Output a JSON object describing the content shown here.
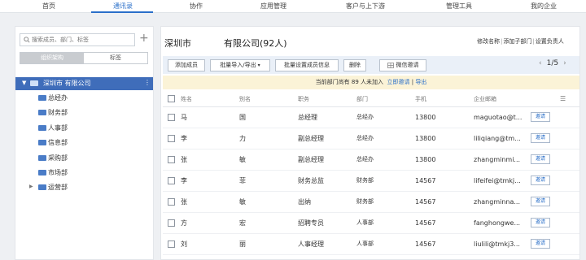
{
  "topnav": {
    "items": [
      {
        "label": "首页"
      },
      {
        "label": "通讯录",
        "active": true
      },
      {
        "label": "协作"
      },
      {
        "label": "应用管理"
      },
      {
        "label": "客户与上下游"
      },
      {
        "label": "管理工具"
      },
      {
        "label": "我的企业"
      }
    ]
  },
  "sidebar": {
    "search_placeholder": "搜索成员、部门、标签",
    "add_symbol": "+",
    "seg_tabs": [
      "组织架构",
      "标签"
    ],
    "root": {
      "caret": "▼",
      "name": "深圳市          有限公司",
      "more": "⋮"
    },
    "departments": [
      {
        "name": "总经办"
      },
      {
        "name": "财务部"
      },
      {
        "name": "人事部"
      },
      {
        "name": "信息部"
      },
      {
        "name": "采购部"
      },
      {
        "name": "市场部"
      },
      {
        "name": "运营部",
        "caret": "▶"
      }
    ]
  },
  "main": {
    "title_left": "深圳市",
    "title_right": "有限公司(92人)",
    "links": [
      "修改名称",
      "添加子部门",
      "设置负责人"
    ],
    "link_sep": "|",
    "toolbar": {
      "add_member": "添加成员",
      "bulk_import": "批量导入/导出",
      "bulk_import_chevron": "▾",
      "bulk_set": "批量设置成员信息",
      "delete": "删除",
      "wechat_invite": "微信邀请",
      "page": "1/5",
      "prev": "‹",
      "next": "›"
    },
    "notice": {
      "text": "当前部门尚有 89 人未加入",
      "invite_link": "立即邀请",
      "sep": "|",
      "export_link": "导出"
    },
    "table": {
      "columns": [
        "姓名",
        "别名",
        "职务",
        "部门",
        "手机",
        "企业邮箱"
      ],
      "colset_icon": "☰",
      "invite_label": "邀请",
      "rows": [
        {
          "surname": "马",
          "given": "国",
          "title": "总经理",
          "dept": "总经办",
          "phone": "13800",
          "email": "maguotao@t..."
        },
        {
          "surname": "李",
          "given": "力",
          "title": "副总经理",
          "dept": "总经办",
          "phone": "13800",
          "email": "liliqiang@tm..."
        },
        {
          "surname": "张",
          "given": "敏",
          "title": "副总经理",
          "dept": "总经办",
          "phone": "13800",
          "email": "zhangminmi..."
        },
        {
          "surname": "李",
          "given": "菲",
          "title": "财务总监",
          "dept": "财务部",
          "phone": "14567",
          "email": "lifeifei@tmkj..."
        },
        {
          "surname": "张",
          "given": "敏",
          "title": "出纳",
          "dept": "财务部",
          "phone": "14567",
          "email": "zhangminna..."
        },
        {
          "surname": "方",
          "given": "宏",
          "title": "招聘专员",
          "dept": "人事部",
          "phone": "14567",
          "email": "fanghongwe..."
        },
        {
          "surname": "刘",
          "given": "丽",
          "title": "人事经理",
          "dept": "人事部",
          "phone": "14567",
          "email": "liulili@tmkj3..."
        }
      ]
    }
  },
  "colors": {
    "accent": "#2a6fc9",
    "tree_selected": "#3f6dba",
    "notice_bg": "#fbf3d7"
  }
}
